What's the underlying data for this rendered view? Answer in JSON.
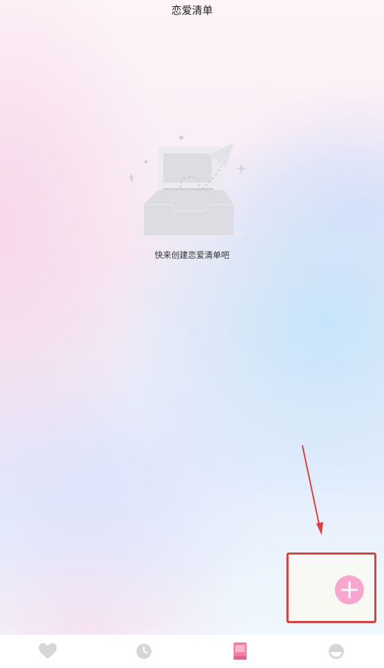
{
  "header": {
    "title": "恋爱清单"
  },
  "empty_state": {
    "message": "快来创建恋爱清单吧"
  },
  "fab": {
    "icon": "plus-icon",
    "color": "#f9a6cf"
  },
  "annotation": {
    "color": "#e23c3c"
  },
  "tabbar": {
    "tabs": [
      {
        "icon": "heart-icon",
        "active": false
      },
      {
        "icon": "clock-icon",
        "active": false
      },
      {
        "icon": "book-icon",
        "active": true,
        "color": "#f27aa5"
      },
      {
        "icon": "profile-icon",
        "active": false
      }
    ],
    "inactive_color": "#d6d6d6"
  }
}
